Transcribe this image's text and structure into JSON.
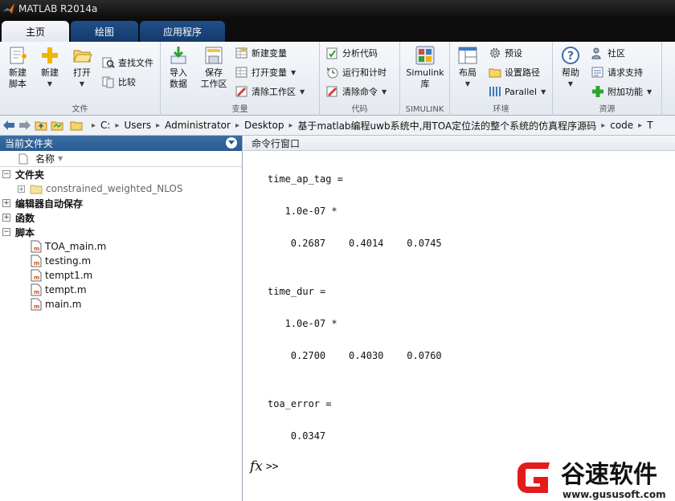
{
  "window": {
    "title": "MATLAB R2014a"
  },
  "tabs": [
    {
      "label": "主页",
      "active": true
    },
    {
      "label": "绘图",
      "active": false
    },
    {
      "label": "应用程序",
      "active": false
    }
  ],
  "ribbon": {
    "file": {
      "group_label": "文件",
      "new_script": "新建\n脚本",
      "new": "新建",
      "open": "打开",
      "find_files": "查找文件",
      "compare": "比较"
    },
    "variable": {
      "group_label": "变量",
      "import_data": "导入\n数据",
      "save_workspace": "保存\n工作区",
      "new_variable": "新建变量",
      "open_variable": "打开变量",
      "clear_workspace": "清除工作区"
    },
    "code": {
      "group_label": "代码",
      "analyze_code": "分析代码",
      "run_and_time": "运行和计时",
      "clear_commands": "清除命令"
    },
    "simulink": {
      "group_label": "SIMULINK",
      "library": "Simulink\n库"
    },
    "environment": {
      "group_label": "环境",
      "layout": "布局",
      "preferences": "预设",
      "set_path": "设置路径",
      "parallel": "Parallel"
    },
    "resources": {
      "group_label": "资源",
      "help": "帮助",
      "community": "社区",
      "request_support": "请求支持",
      "add_ons": "附加功能"
    }
  },
  "address_bar": {
    "crumbs": [
      "C:",
      "Users",
      "Administrator",
      "Desktop",
      "基于matlab编程uwb系统中,用TOA定位法的整个系统的仿真程序源码",
      "code",
      "T"
    ]
  },
  "current_folder": {
    "title": "当前文件夹",
    "column_header": "名称",
    "sections": {
      "folders": "文件夹",
      "autosave": "编辑器自动保存",
      "functions": "函数",
      "scripts": "脚本"
    },
    "folders": [
      "constrained_weighted_NLOS"
    ],
    "scripts": [
      "TOA_main.m",
      "testing.m",
      "tempt1.m",
      "tempt.m",
      "main.m"
    ]
  },
  "command_window": {
    "title": "命令行窗口",
    "lines": [
      {
        "text": "time_ap_tag =",
        "indent": 0
      },
      {
        "text": "",
        "indent": 0
      },
      {
        "text": "1.0e-07 *",
        "indent": 3
      },
      {
        "text": "",
        "indent": 0
      },
      {
        "text": "0.2687    0.4014    0.0745",
        "indent": 4
      },
      {
        "text": "",
        "indent": 0
      },
      {
        "text": "",
        "indent": 0
      },
      {
        "text": "time_dur =",
        "indent": 0
      },
      {
        "text": "",
        "indent": 0
      },
      {
        "text": "1.0e-07 *",
        "indent": 3
      },
      {
        "text": "",
        "indent": 0
      },
      {
        "text": "0.2700    0.4030    0.0760",
        "indent": 4
      },
      {
        "text": "",
        "indent": 0
      },
      {
        "text": "",
        "indent": 0
      },
      {
        "text": "toa_error =",
        "indent": 0
      },
      {
        "text": "",
        "indent": 0
      },
      {
        "text": "0.0347",
        "indent": 4
      }
    ],
    "prompt_fx": "fx",
    "prompt": ">>"
  },
  "watermark": {
    "brand": "谷速软件",
    "url": "www.gususoft.com"
  }
}
